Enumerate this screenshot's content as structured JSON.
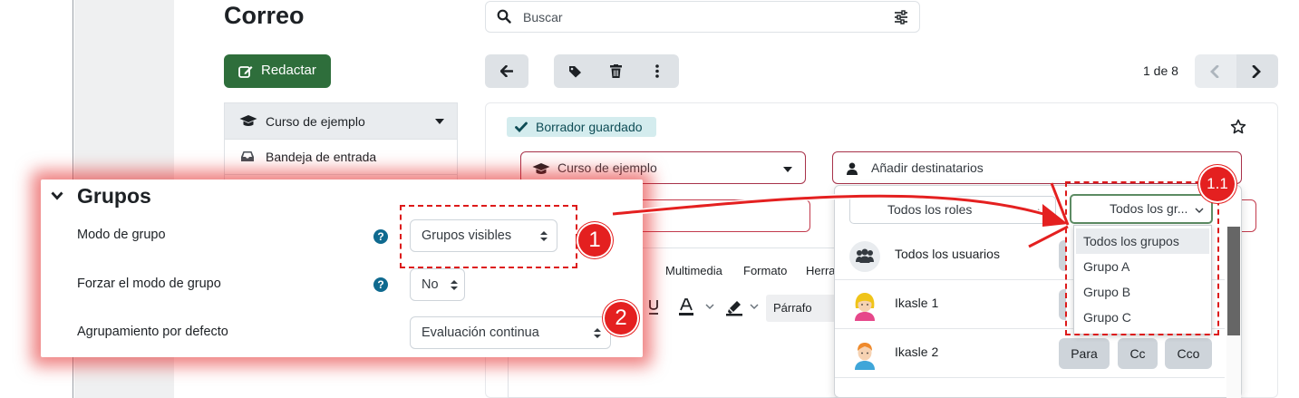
{
  "page": {
    "title": "Correo"
  },
  "search": {
    "placeholder": "Buscar"
  },
  "compose": {
    "label": "Redactar"
  },
  "pager": {
    "label": "1 de 8"
  },
  "sidebar": {
    "course_label": "Curso de ejemplo",
    "inbox_label": "Bandeja de entrada"
  },
  "message": {
    "status_badge": "Borrador guardado",
    "course_select": "Curso de ejemplo",
    "add_recipients": "Añadir destinatarios",
    "ghost_close": "×"
  },
  "editor": {
    "menu": [
      "r",
      "Multimedia",
      "Formato",
      "Herra"
    ],
    "paragraph": "Párrafo"
  },
  "recipients_dropdown": {
    "roles_select": "Todos los roles",
    "groups_select": "Todos los gr...",
    "users": [
      {
        "name": "Todos los usuarios",
        "icon": "users-group-icon"
      },
      {
        "name": "Ikasle 1",
        "icon": "female-avatar-icon"
      },
      {
        "name": "Ikasle 2",
        "icon": "male-avatar-icon"
      }
    ],
    "buttons": {
      "to": "Para",
      "cc": "Cc",
      "bcc": "Cco"
    },
    "group_options": [
      "Todos los grupos",
      "Grupo A",
      "Grupo B",
      "Grupo C"
    ],
    "selected_group": "Todos los grupos"
  },
  "groups_panel": {
    "heading": "Grupos",
    "rows": [
      {
        "label": "Modo de grupo",
        "value": "Grupos visibles",
        "help": "?"
      },
      {
        "label": "Forzar el modo de grupo",
        "value": "No",
        "help": "?"
      },
      {
        "label": "Agrupamiento por defecto",
        "value": "Evaluación continua"
      }
    ]
  },
  "annotations": {
    "one": "1",
    "two": "2",
    "one_one": "1.1"
  },
  "colors": {
    "accent_green": "#2e6e3b",
    "annotation_red": "#e42020",
    "badge_bg": "#d4ecee"
  }
}
